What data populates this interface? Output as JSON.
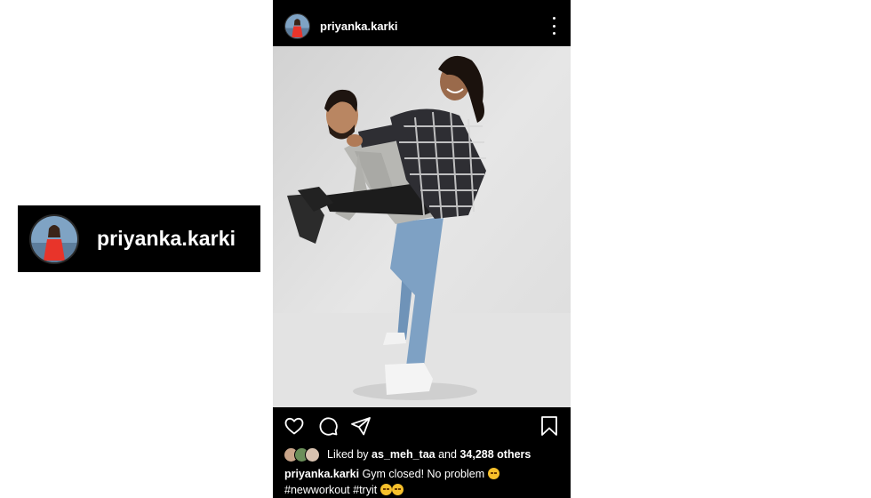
{
  "zoom_badge": {
    "username": "priyanka.karki"
  },
  "post": {
    "header": {
      "username": "priyanka.karki",
      "more_icon": "more-vertical-icon"
    },
    "photo": {
      "subject": "photo-of-two-people"
    },
    "actions": {
      "like_icon": "heart-icon",
      "comment_icon": "comment-icon",
      "share_icon": "send-icon",
      "save_icon": "bookmark-icon"
    },
    "likes": {
      "prefix": "Liked by",
      "user": "as_meh_taa",
      "joiner": "and",
      "others": "34,288 others"
    },
    "caption": {
      "username": "priyanka.karki",
      "text": "Gym closed! No problem",
      "hashtags": "#newworkout #tryit"
    }
  },
  "colors": {
    "background": "#000000",
    "text": "#ffffff",
    "page": "#ffffff"
  }
}
